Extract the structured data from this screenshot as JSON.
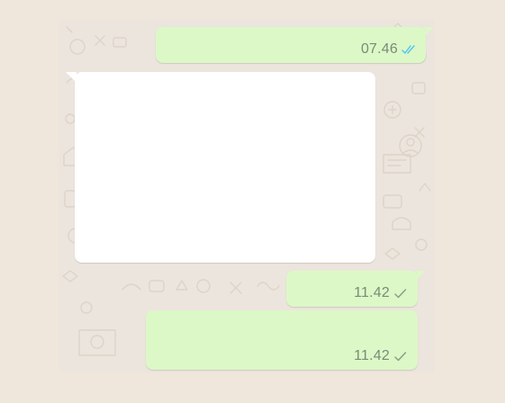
{
  "chat": {
    "messages": [
      {
        "direction": "outgoing",
        "time": "07.46",
        "status": "read",
        "status_icon": "double-check-icon"
      },
      {
        "direction": "incoming",
        "text": ""
      },
      {
        "direction": "outgoing",
        "time": "11.42",
        "status": "sent",
        "status_icon": "single-check-icon"
      },
      {
        "direction": "outgoing",
        "time": "11.42",
        "status": "sent",
        "status_icon": "single-check-icon"
      }
    ]
  },
  "colors": {
    "page_background": "#efe6dc",
    "chat_background": "#ece5dd",
    "outgoing_bubble": "#dcf8c6",
    "incoming_bubble": "#ffffff",
    "time_text": "#7b8a7a",
    "read_tick": "#4fc3f7",
    "sent_tick": "#8a9a88"
  }
}
